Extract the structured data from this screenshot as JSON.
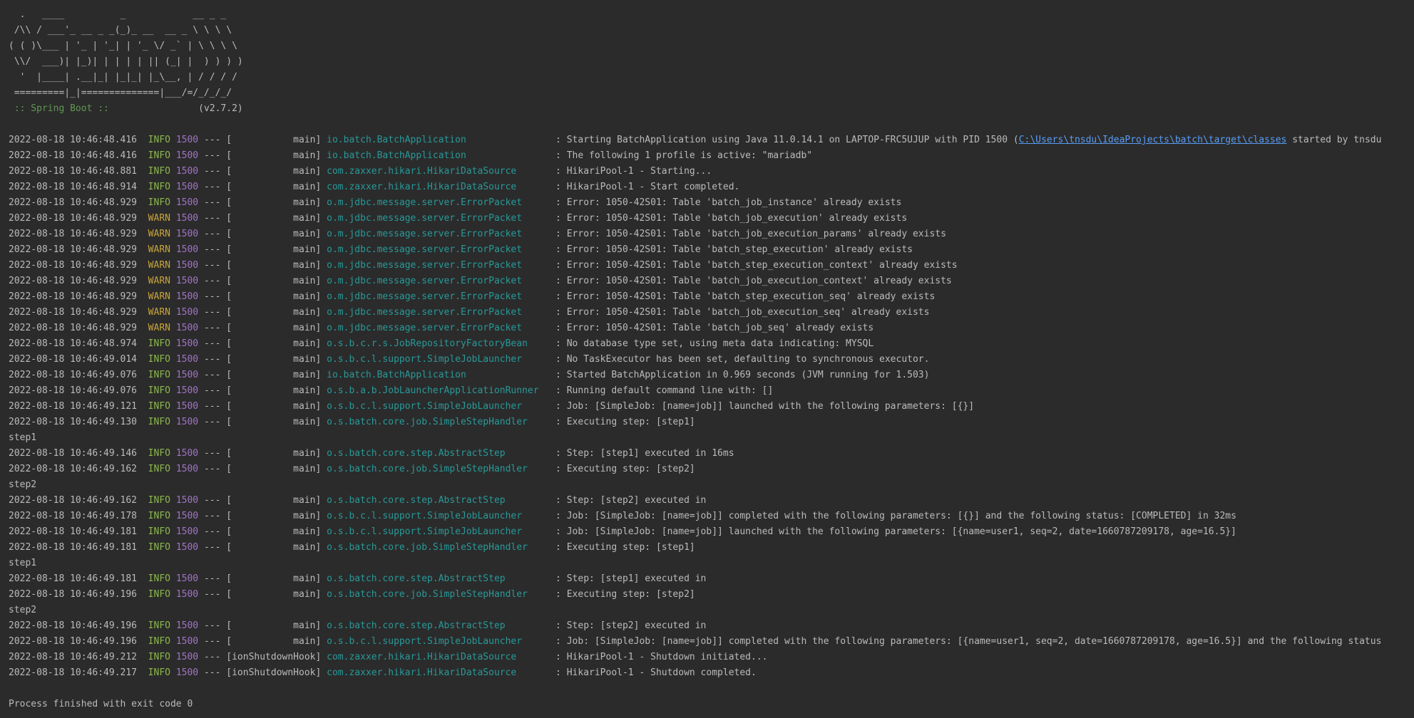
{
  "banner": {
    "lines": [
      "  .   ____          _            __ _ _",
      " /\\\\ / ___'_ __ _ _(_)_ __  __ _ \\ \\ \\ \\",
      "( ( )\\___ | '_ | '_| | '_ \\/ _` | \\ \\ \\ \\",
      " \\\\/  ___)| |_)| | | | | || (_| |  ) ) ) )",
      "  '  |____| .__|_| |_|_| |_\\__, | / / / /",
      " =========|_|==============|___/=/_/_/_/"
    ],
    "spring_label": " :: Spring Boot :: ",
    "version": "               (v2.7.2)"
  },
  "colors": {
    "background": "#2b2b2b",
    "text": "#bbbbbb",
    "info": "#8bb84a",
    "warn": "#c9a43b",
    "pid": "#a074c4",
    "logger": "#299999",
    "link": "#589df6"
  },
  "log": [
    {
      "ts": "2022-08-18 10:46:48.416",
      "level": "INFO",
      "pid": "1500",
      "thread": "main",
      "logger": "io.batch.BatchApplication",
      "msg": "Starting BatchApplication using Java 11.0.14.1 on LAPTOP-FRC5UJUP with PID 1500 (",
      "link": "C:\\Users\\tnsdu\\IdeaProjects\\batch\\target\\classes",
      "msg_after": " started by tnsdu"
    },
    {
      "ts": "2022-08-18 10:46:48.416",
      "level": "INFO",
      "pid": "1500",
      "thread": "main",
      "logger": "io.batch.BatchApplication",
      "msg": "The following 1 profile is active: \"mariadb\""
    },
    {
      "ts": "2022-08-18 10:46:48.881",
      "level": "INFO",
      "pid": "1500",
      "thread": "main",
      "logger": "com.zaxxer.hikari.HikariDataSource",
      "msg": "HikariPool-1 - Starting..."
    },
    {
      "ts": "2022-08-18 10:46:48.914",
      "level": "INFO",
      "pid": "1500",
      "thread": "main",
      "logger": "com.zaxxer.hikari.HikariDataSource",
      "msg": "HikariPool-1 - Start completed."
    },
    {
      "ts": "2022-08-18 10:46:48.929",
      "level": "INFO",
      "pid": "1500",
      "thread": "main",
      "logger": "o.m.jdbc.message.server.ErrorPacket",
      "msg": "Error: 1050-42S01: Table 'batch_job_instance' already exists"
    },
    {
      "ts": "2022-08-18 10:46:48.929",
      "level": "WARN",
      "pid": "1500",
      "thread": "main",
      "logger": "o.m.jdbc.message.server.ErrorPacket",
      "msg": "Error: 1050-42S01: Table 'batch_job_execution' already exists"
    },
    {
      "ts": "2022-08-18 10:46:48.929",
      "level": "WARN",
      "pid": "1500",
      "thread": "main",
      "logger": "o.m.jdbc.message.server.ErrorPacket",
      "msg": "Error: 1050-42S01: Table 'batch_job_execution_params' already exists"
    },
    {
      "ts": "2022-08-18 10:46:48.929",
      "level": "WARN",
      "pid": "1500",
      "thread": "main",
      "logger": "o.m.jdbc.message.server.ErrorPacket",
      "msg": "Error: 1050-42S01: Table 'batch_step_execution' already exists"
    },
    {
      "ts": "2022-08-18 10:46:48.929",
      "level": "WARN",
      "pid": "1500",
      "thread": "main",
      "logger": "o.m.jdbc.message.server.ErrorPacket",
      "msg": "Error: 1050-42S01: Table 'batch_step_execution_context' already exists"
    },
    {
      "ts": "2022-08-18 10:46:48.929",
      "level": "WARN",
      "pid": "1500",
      "thread": "main",
      "logger": "o.m.jdbc.message.server.ErrorPacket",
      "msg": "Error: 1050-42S01: Table 'batch_job_execution_context' already exists"
    },
    {
      "ts": "2022-08-18 10:46:48.929",
      "level": "WARN",
      "pid": "1500",
      "thread": "main",
      "logger": "o.m.jdbc.message.server.ErrorPacket",
      "msg": "Error: 1050-42S01: Table 'batch_step_execution_seq' already exists"
    },
    {
      "ts": "2022-08-18 10:46:48.929",
      "level": "WARN",
      "pid": "1500",
      "thread": "main",
      "logger": "o.m.jdbc.message.server.ErrorPacket",
      "msg": "Error: 1050-42S01: Table 'batch_job_execution_seq' already exists"
    },
    {
      "ts": "2022-08-18 10:46:48.929",
      "level": "WARN",
      "pid": "1500",
      "thread": "main",
      "logger": "o.m.jdbc.message.server.ErrorPacket",
      "msg": "Error: 1050-42S01: Table 'batch_job_seq' already exists"
    },
    {
      "ts": "2022-08-18 10:46:48.974",
      "level": "INFO",
      "pid": "1500",
      "thread": "main",
      "logger": "o.s.b.c.r.s.JobRepositoryFactoryBean",
      "msg": "No database type set, using meta data indicating: MYSQL"
    },
    {
      "ts": "2022-08-18 10:46:49.014",
      "level": "INFO",
      "pid": "1500",
      "thread": "main",
      "logger": "o.s.b.c.l.support.SimpleJobLauncher",
      "msg": "No TaskExecutor has been set, defaulting to synchronous executor."
    },
    {
      "ts": "2022-08-18 10:46:49.076",
      "level": "INFO",
      "pid": "1500",
      "thread": "main",
      "logger": "io.batch.BatchApplication",
      "msg": "Started BatchApplication in 0.969 seconds (JVM running for 1.503)"
    },
    {
      "ts": "2022-08-18 10:46:49.076",
      "level": "INFO",
      "pid": "1500",
      "thread": "main",
      "logger": "o.s.b.a.b.JobLauncherApplicationRunner",
      "msg": "Running default command line with: []"
    },
    {
      "ts": "2022-08-18 10:46:49.121",
      "level": "INFO",
      "pid": "1500",
      "thread": "main",
      "logger": "o.s.b.c.l.support.SimpleJobLauncher",
      "msg": "Job: [SimpleJob: [name=job]] launched with the following parameters: [{}]"
    },
    {
      "ts": "2022-08-18 10:46:49.130",
      "level": "INFO",
      "pid": "1500",
      "thread": "main",
      "logger": "o.s.batch.core.job.SimpleStepHandler",
      "msg": "Executing step: [step1]"
    },
    {
      "plain": "step1"
    },
    {
      "ts": "2022-08-18 10:46:49.146",
      "level": "INFO",
      "pid": "1500",
      "thread": "main",
      "logger": "o.s.batch.core.step.AbstractStep",
      "msg": "Step: [step1] executed in 16ms"
    },
    {
      "ts": "2022-08-18 10:46:49.162",
      "level": "INFO",
      "pid": "1500",
      "thread": "main",
      "logger": "o.s.batch.core.job.SimpleStepHandler",
      "msg": "Executing step: [step2]"
    },
    {
      "plain": "step2"
    },
    {
      "ts": "2022-08-18 10:46:49.162",
      "level": "INFO",
      "pid": "1500",
      "thread": "main",
      "logger": "o.s.batch.core.step.AbstractStep",
      "msg": "Step: [step2] executed in"
    },
    {
      "ts": "2022-08-18 10:46:49.178",
      "level": "INFO",
      "pid": "1500",
      "thread": "main",
      "logger": "o.s.b.c.l.support.SimpleJobLauncher",
      "msg": "Job: [SimpleJob: [name=job]] completed with the following parameters: [{}] and the following status: [COMPLETED] in 32ms"
    },
    {
      "ts": "2022-08-18 10:46:49.181",
      "level": "INFO",
      "pid": "1500",
      "thread": "main",
      "logger": "o.s.b.c.l.support.SimpleJobLauncher",
      "msg": "Job: [SimpleJob: [name=job]] launched with the following parameters: [{name=user1, seq=2, date=1660787209178, age=16.5}]"
    },
    {
      "ts": "2022-08-18 10:46:49.181",
      "level": "INFO",
      "pid": "1500",
      "thread": "main",
      "logger": "o.s.batch.core.job.SimpleStepHandler",
      "msg": "Executing step: [step1]"
    },
    {
      "plain": "step1"
    },
    {
      "ts": "2022-08-18 10:46:49.181",
      "level": "INFO",
      "pid": "1500",
      "thread": "main",
      "logger": "o.s.batch.core.step.AbstractStep",
      "msg": "Step: [step1] executed in"
    },
    {
      "ts": "2022-08-18 10:46:49.196",
      "level": "INFO",
      "pid": "1500",
      "thread": "main",
      "logger": "o.s.batch.core.job.SimpleStepHandler",
      "msg": "Executing step: [step2]"
    },
    {
      "plain": "step2"
    },
    {
      "ts": "2022-08-18 10:46:49.196",
      "level": "INFO",
      "pid": "1500",
      "thread": "main",
      "logger": "o.s.batch.core.step.AbstractStep",
      "msg": "Step: [step2] executed in"
    },
    {
      "ts": "2022-08-18 10:46:49.196",
      "level": "INFO",
      "pid": "1500",
      "thread": "main",
      "logger": "o.s.b.c.l.support.SimpleJobLauncher",
      "msg": "Job: [SimpleJob: [name=job]] completed with the following parameters: [{name=user1, seq=2, date=1660787209178, age=16.5}] and the following status"
    },
    {
      "ts": "2022-08-18 10:46:49.212",
      "level": "INFO",
      "pid": "1500",
      "thread": "ionShutdownHook",
      "logger": "com.zaxxer.hikari.HikariDataSource",
      "msg": "HikariPool-1 - Shutdown initiated..."
    },
    {
      "ts": "2022-08-18 10:46:49.217",
      "level": "INFO",
      "pid": "1500",
      "thread": "ionShutdownHook",
      "logger": "com.zaxxer.hikari.HikariDataSource",
      "msg": "HikariPool-1 - Shutdown completed."
    }
  ],
  "exit_message": "Process finished with exit code 0"
}
